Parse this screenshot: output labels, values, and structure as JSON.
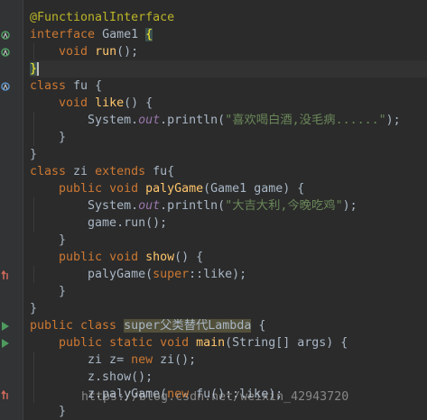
{
  "editor": {
    "lines": [
      [
        {
          "t": "@FunctionalInterface",
          "c": "ann"
        }
      ],
      [
        {
          "t": "interface ",
          "c": "kw"
        },
        {
          "t": "Game1 ",
          "c": "txt"
        },
        {
          "t": "{",
          "c": "brace-hl"
        }
      ],
      [
        {
          "t": "    "
        },
        {
          "t": "void ",
          "c": "kw"
        },
        {
          "t": "run",
          "c": "fn"
        },
        {
          "t": "();",
          "c": "txt"
        }
      ],
      [
        {
          "t": "}",
          "c": "brace-hl"
        },
        {
          "caret": true
        }
      ],
      [
        {
          "t": "class ",
          "c": "kw"
        },
        {
          "t": "fu {",
          "c": "txt"
        }
      ],
      [
        {
          "t": "    "
        },
        {
          "t": "void ",
          "c": "kw"
        },
        {
          "t": "like",
          "c": "fn"
        },
        {
          "t": "() {",
          "c": "txt"
        }
      ],
      [
        {
          "t": "        System.",
          "c": "txt"
        },
        {
          "t": "out",
          "c": "fld"
        },
        {
          "t": ".println(",
          "c": "txt"
        },
        {
          "t": "\"喜欢喝白酒,没毛病......\"",
          "c": "str"
        },
        {
          "t": ");",
          "c": "txt"
        }
      ],
      [
        {
          "t": "    }",
          "c": "txt"
        }
      ],
      [
        {
          "t": "}",
          "c": "txt"
        }
      ],
      [
        {
          "t": "class ",
          "c": "kw"
        },
        {
          "t": "zi ",
          "c": "txt"
        },
        {
          "t": "extends ",
          "c": "kw"
        },
        {
          "t": "fu{",
          "c": "txt"
        }
      ],
      [
        {
          "t": "    "
        },
        {
          "t": "public void ",
          "c": "kw"
        },
        {
          "t": "palyGame",
          "c": "fn"
        },
        {
          "t": "(Game1 game) {",
          "c": "txt"
        }
      ],
      [
        {
          "t": "        System.",
          "c": "txt"
        },
        {
          "t": "out",
          "c": "fld"
        },
        {
          "t": ".println(",
          "c": "txt"
        },
        {
          "t": "\"大吉大利,今晚吃鸡\"",
          "c": "str"
        },
        {
          "t": ");",
          "c": "txt"
        }
      ],
      [
        {
          "t": "        game.run();",
          "c": "txt"
        }
      ],
      [
        {
          "t": "    }",
          "c": "txt"
        }
      ],
      [
        {
          "t": "    "
        },
        {
          "t": "public void ",
          "c": "kw"
        },
        {
          "t": "show",
          "c": "fn"
        },
        {
          "t": "() {",
          "c": "txt"
        }
      ],
      [
        {
          "t": "        palyGame(",
          "c": "txt"
        },
        {
          "t": "super",
          "c": "kw"
        },
        {
          "t": "::like);",
          "c": "txt"
        }
      ],
      [
        {
          "t": "    }",
          "c": "txt"
        }
      ],
      [
        {
          "t": "}",
          "c": "txt"
        }
      ],
      [
        {
          "t": "public class ",
          "c": "kw"
        },
        {
          "t": "super父类替代Lambda",
          "c": "txt cls-hl"
        },
        {
          "t": " {",
          "c": "txt"
        }
      ],
      [
        {
          "t": "    "
        },
        {
          "t": "public static void ",
          "c": "kw"
        },
        {
          "t": "main",
          "c": "fn"
        },
        {
          "t": "(String[] args) {",
          "c": "txt"
        }
      ],
      [
        {
          "t": "        zi z= ",
          "c": "txt"
        },
        {
          "t": "new ",
          "c": "kw"
        },
        {
          "t": "zi();",
          "c": "txt"
        }
      ],
      [
        {
          "t": "        z.show();",
          "c": "txt"
        }
      ],
      [
        {
          "t": "        z.palyGame(",
          "c": "txt"
        },
        {
          "t": "new ",
          "c": "kw"
        },
        {
          "t": "fu()::like);",
          "c": "txt"
        }
      ],
      [
        {
          "t": "    }",
          "c": "txt"
        }
      ]
    ],
    "caret_line": 3
  },
  "gutter_icons": [
    {
      "line": 1,
      "name": "implemented-interface-icon",
      "color": "#4e9a5e"
    },
    {
      "line": 2,
      "name": "implemented-method-icon",
      "color": "#4e9a5e"
    },
    {
      "line": 4,
      "name": "overridden-class-icon",
      "color": "#5a8fc4"
    },
    {
      "line": 15,
      "name": "recursive-call-icon",
      "color": "#cf6a5b"
    },
    {
      "line": 18,
      "name": "run-class-icon",
      "color": "#4e9a5e"
    },
    {
      "line": 19,
      "name": "run-main-icon",
      "color": "#4e9a5e"
    },
    {
      "line": 22,
      "name": "recursive-call-icon",
      "color": "#cf6a5b"
    }
  ],
  "watermark": "https://blog.csdn.net/weixin_42943720"
}
